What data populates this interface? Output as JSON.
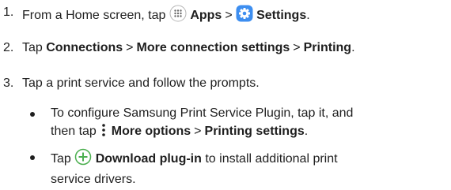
{
  "steps": [
    {
      "num": "1.",
      "parts": {
        "a": "From a Home screen, tap",
        "apps": "Apps",
        "sep": ">",
        "settings": "Settings",
        "end": "."
      }
    },
    {
      "num": "2.",
      "parts": {
        "a": "Tap",
        "connections": "Connections",
        "sep1": ">",
        "more": "More connection settings",
        "sep2": ">",
        "printing": "Printing",
        "end": "."
      }
    },
    {
      "num": "3.",
      "parts": {
        "a": "Tap a print service and follow the prompts."
      }
    }
  ],
  "bullets": [
    {
      "line1": "To configure Samsung Print Service Plugin, tap it, and",
      "line2_a": "then tap",
      "more_options": "More options",
      "sep": ">",
      "printing_settings": "Printing settings",
      "end": "."
    },
    {
      "a": "Tap",
      "download": "Download plug-in",
      "line1_end": "to install additional print",
      "line2": "service drivers."
    }
  ],
  "icons": {
    "apps": "apps-grid-icon",
    "settings": "settings-gear-icon",
    "more_options": "more-options-icon",
    "add": "add-plus-icon"
  },
  "colors": {
    "text": "#1f1f1f",
    "settings_icon_bg": "#3d8ef0",
    "add_icon": "#4caf50"
  }
}
